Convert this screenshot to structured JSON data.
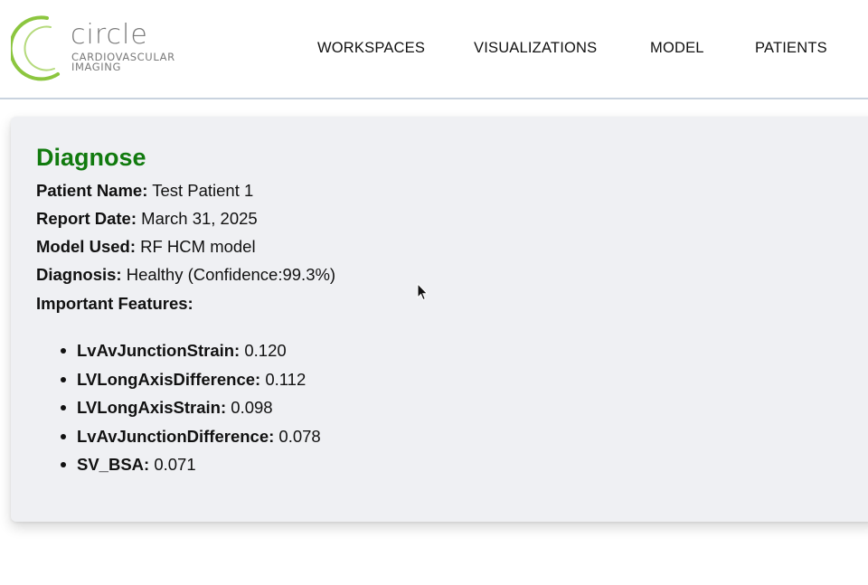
{
  "logo": {
    "word": "circle",
    "line1": "CARDIOVASCULAR",
    "line2": "IMAGING",
    "accent_color": "#8cc63f"
  },
  "nav": {
    "items": [
      "WORKSPACES",
      "VISUALIZATIONS",
      "MODEL",
      "PATIENTS"
    ]
  },
  "report": {
    "title": "Diagnose",
    "title_color": "#117a0e",
    "patient_name_label": "Patient Name:",
    "patient_name": "Test Patient 1",
    "report_date_label": "Report Date:",
    "report_date": "March 31, 2025",
    "model_label": "Model Used:",
    "model": "RF HCM model",
    "diagnosis_label": "Diagnosis:",
    "diagnosis": "Healthy (Confidence:99.3%)",
    "features_label": "Important Features:",
    "features": [
      {
        "name": "LvAvJunctionStrain:",
        "value": "0.120"
      },
      {
        "name": "LVLongAxisDifference:",
        "value": "0.112"
      },
      {
        "name": "LVLongAxisStrain:",
        "value": "0.098"
      },
      {
        "name": "LvAvJunctionDifference:",
        "value": "0.078"
      },
      {
        "name": "SV_BSA:",
        "value": "0.071"
      }
    ]
  }
}
